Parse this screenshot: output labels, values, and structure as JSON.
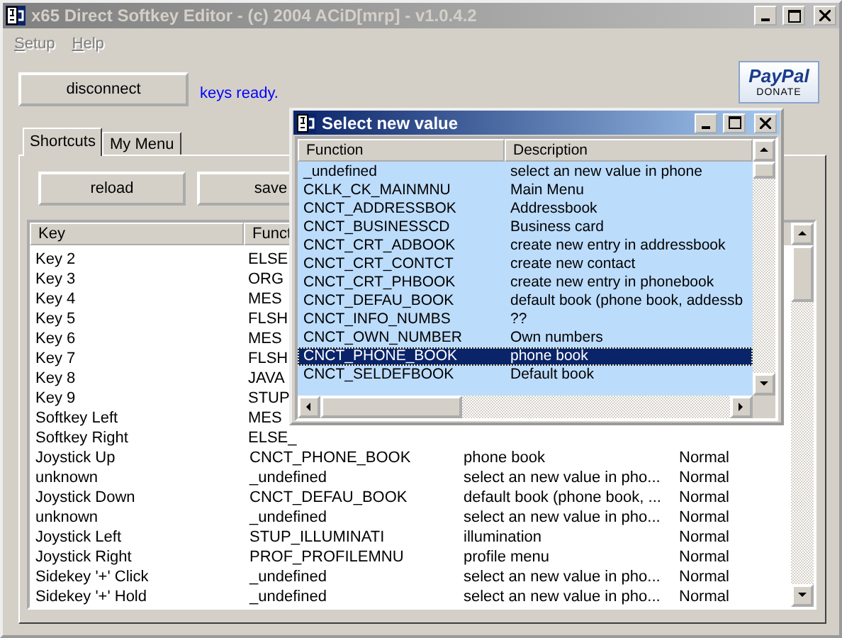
{
  "window": {
    "title": "x65 Direct Softkey Editor - (c) 2004 ACiD[mrp] - v1.0.4.2"
  },
  "menu": [
    "Setup",
    "Help"
  ],
  "connect_button": "disconnect",
  "status": "keys ready.",
  "donate": {
    "brand": "PayPal",
    "label": "DONATE"
  },
  "tabs": [
    {
      "label": "Shortcuts",
      "selected": true
    },
    {
      "label": "My Menu",
      "selected": false
    }
  ],
  "toolbar": [
    "reload",
    "save"
  ],
  "table": {
    "columns": [
      "Key",
      "Funct"
    ],
    "rows": [
      {
        "key": "Key 2",
        "function": "ELSE"
      },
      {
        "key": "Key 3",
        "function": "ORG"
      },
      {
        "key": "Key 4",
        "function": "MES"
      },
      {
        "key": "Key 5",
        "function": "FLSH"
      },
      {
        "key": "Key 6",
        "function": "MES"
      },
      {
        "key": "Key 7",
        "function": "FLSH"
      },
      {
        "key": "Key 8",
        "function": "JAVA"
      },
      {
        "key": "Key 9",
        "function": "STUP"
      },
      {
        "key": "Softkey Left",
        "function": "MES"
      },
      {
        "key": "Softkey Right",
        "function": "ELSE_"
      },
      {
        "key": "Joystick Up",
        "function": "CNCT_PHONE_BOOK",
        "description": "phone book",
        "column_4": "Normal"
      },
      {
        "key": "unknown",
        "function": "_undefined",
        "description": "select an new value in pho...",
        "column_4": "Normal"
      },
      {
        "key": "Joystick Down",
        "function": "CNCT_DEFAU_BOOK",
        "description": "default book (phone book, ...",
        "column_4": "Normal"
      },
      {
        "key": "unknown",
        "function": "_undefined",
        "description": "select an new value in pho...",
        "column_4": "Normal"
      },
      {
        "key": "Joystick Left",
        "function": "STUP_ILLUMINATI",
        "description": "illumination",
        "column_4": "Normal"
      },
      {
        "key": "Joystick Right",
        "function": "PROF_PROFILEMNU",
        "description": "profile menu",
        "column_4": "Normal"
      },
      {
        "key": "Sidekey '+' Click",
        "function": "_undefined",
        "description": "select an new value in pho...",
        "column_4": "Normal"
      },
      {
        "key": "Sidekey '+' Hold",
        "function": "_undefined",
        "description": "select an new value in pho...",
        "column_4": "Normal"
      }
    ]
  },
  "dialog": {
    "title": "Select new value",
    "columns": [
      "Function",
      "Description"
    ],
    "rows": [
      {
        "function": "_undefined",
        "description": "select an new value in phone",
        "selected": false
      },
      {
        "function": "CKLK_CK_MAINMNU",
        "description": "Main Menu",
        "selected": false
      },
      {
        "function": "CNCT_ADDRESSBOK",
        "description": "Addressbook",
        "selected": false
      },
      {
        "function": "CNCT_BUSINESSCD",
        "description": "Business card",
        "selected": false
      },
      {
        "function": "CNCT_CRT_ADBOOK",
        "description": "create new entry in addressbook",
        "selected": false
      },
      {
        "function": "CNCT_CRT_CONTCT",
        "description": "create new contact",
        "selected": false
      },
      {
        "function": "CNCT_CRT_PHBOOK",
        "description": "create new entry in phonebook",
        "selected": false
      },
      {
        "function": "CNCT_DEFAU_BOOK",
        "description": "default book (phone book, addessb",
        "selected": false
      },
      {
        "function": "CNCT_INFO_NUMBS",
        "description": "??",
        "selected": false
      },
      {
        "function": "CNCT_OWN_NUMBER",
        "description": "Own numbers",
        "selected": false
      },
      {
        "function": "CNCT_PHONE_BOOK",
        "description": "phone book",
        "selected": true
      },
      {
        "function": "CNCT_SELDEFBOOK",
        "description": "Default book",
        "selected": false
      }
    ]
  }
}
